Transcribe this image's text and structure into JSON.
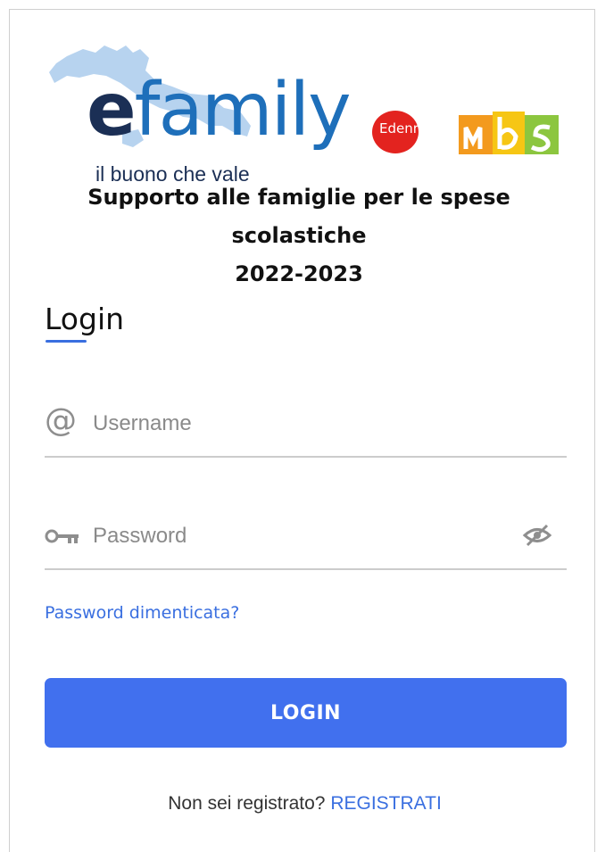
{
  "brand": {
    "logo_e": "e",
    "logo_rest": "family",
    "tagline": "il buono che vale",
    "partner1": "Edenred",
    "partner2": "Mbs",
    "colors": {
      "efamily_blue": "#1e6fba",
      "navy": "#1b2f55",
      "edenred_red": "#e3231f",
      "map_blue": "#b7d3ef"
    }
  },
  "heading": {
    "line1": "Supporto alle famiglie per le spese",
    "line2": "scolastiche",
    "line3": "2022-2023"
  },
  "login": {
    "title": "Login",
    "username": {
      "icon": "at-icon",
      "value": "",
      "placeholder": "Username"
    },
    "password": {
      "icon": "key-icon",
      "value": "",
      "placeholder": "Password",
      "toggle_icon": "eye-off-icon"
    },
    "forgot_label": "Password dimenticata?",
    "button_label": "LOGIN",
    "accent": "#4170ee"
  },
  "register": {
    "prompt": "Non sei registrato?",
    "link_label": "REGISTRATI"
  }
}
